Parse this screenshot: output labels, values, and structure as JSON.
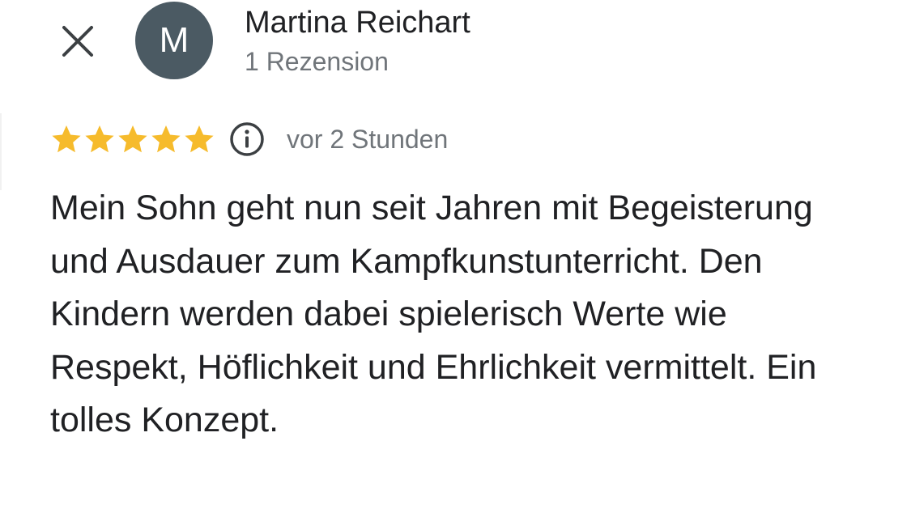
{
  "header": {
    "close_icon": "close-icon",
    "avatar_initial": "M",
    "avatar_color": "#4b5a63",
    "author_name": "Martina Reichart",
    "review_count": "1 Rezension"
  },
  "review": {
    "rating": 5,
    "rating_max": 5,
    "star_color": "#f6bb2c",
    "info_icon": "info-icon",
    "time_ago": "vor 2 Stunden",
    "text": "Mein Sohn geht nun seit Jahren mit Begeisterung und Ausdauer zum Kampfkunstunterricht. Den Kindern werden dabei spielerisch Werte wie Respekt, Höflichkeit und Ehrlichkeit vermittelt. Ein tolles Konzept."
  },
  "colors": {
    "text_primary": "#202124",
    "text_secondary": "#70757a",
    "icon": "#3c4043"
  }
}
